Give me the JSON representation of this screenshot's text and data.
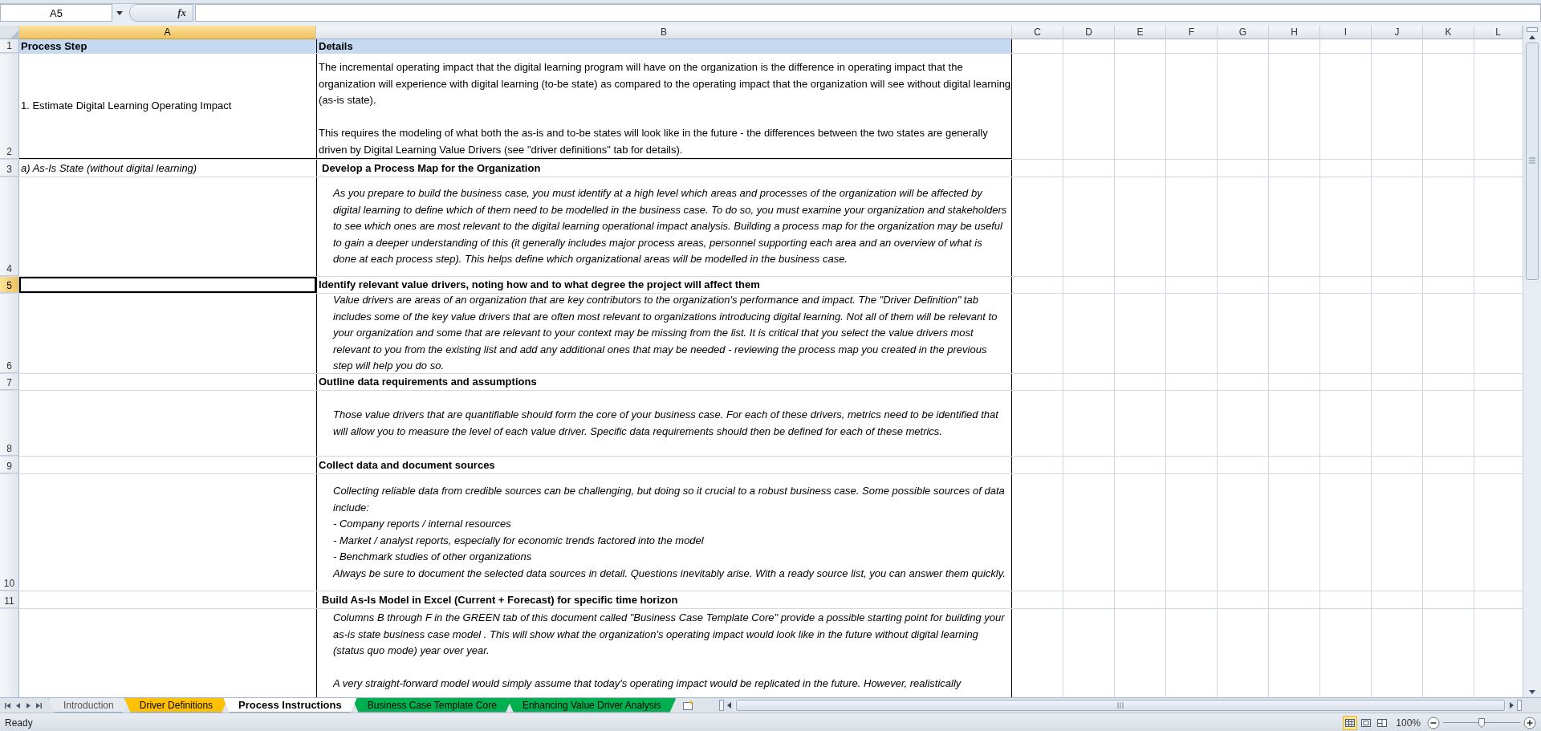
{
  "formula_bar": {
    "name_box": "A5",
    "function_button": "fx"
  },
  "columns": [
    {
      "label": "A",
      "selected": true
    },
    {
      "label": "B",
      "selected": false
    },
    {
      "label": "C",
      "selected": false
    },
    {
      "label": "D",
      "selected": false
    },
    {
      "label": "E",
      "selected": false
    },
    {
      "label": "F",
      "selected": false
    },
    {
      "label": "G",
      "selected": false
    },
    {
      "label": "H",
      "selected": false
    },
    {
      "label": "I",
      "selected": false
    },
    {
      "label": "J",
      "selected": false
    },
    {
      "label": "K",
      "selected": false
    },
    {
      "label": "L",
      "selected": false
    }
  ],
  "rows": [
    {
      "number": "1",
      "selected": false,
      "a": {
        "kind": "header",
        "text": "Process Step"
      },
      "b": {
        "kind": "header",
        "text": "Details"
      }
    },
    {
      "number": "2",
      "selected": false,
      "a": {
        "kind": "label",
        "text": "1. Estimate Digital Learning Operating Impact"
      },
      "b": {
        "kind": "paragraph",
        "text": "The incremental operating impact that the digital learning program will have on the organization is the difference in operating impact that the organization will experience with digital learning (to-be state) as compared to the operating impact that the organization will see without digital learning (as-is state).\n\nThis requires the modeling of what both the as-is and to-be states will look like in the future - the differences between the two states are generally driven by Digital Learning Value Drivers (see \"driver definitions\" tab for details)."
      }
    },
    {
      "number": "3",
      "selected": false,
      "a": {
        "kind": "italic_label",
        "text": "a) As-Is State (without digital learning)"
      },
      "b": {
        "kind": "heading",
        "indented": true,
        "text": "Develop a Process Map for the Organization"
      }
    },
    {
      "number": "4",
      "selected": false,
      "b": {
        "kind": "description",
        "text": "As you prepare to build the business case, you must identify at a high level which areas and processes of the organization will be affected by digital learning to define which of them need to be modelled in the business case. To do so, you must examine your organization and stakeholders to see which ones are most relevant to the digital learning operational impact analysis. Building a process map for the organization may be useful to gain a deeper understanding of this (it generally includes major process areas, personnel supporting each area and an overview of what is done at each process step). This helps define which organizational areas will be modelled in the business case."
      }
    },
    {
      "number": "5",
      "selected": true,
      "b": {
        "kind": "heading",
        "indented": false,
        "text": "Identify relevant value drivers, noting how and to what degree the project will affect them"
      }
    },
    {
      "number": "6",
      "selected": false,
      "b": {
        "kind": "description",
        "text": "Value drivers are areas of an organization that are key contributors to the organization's performance and impact. The \"Driver Definition\" tab includes some of the key value drivers that are often most relevant to organizations introducing digital learning. Not all of them will be relevant to your organization and some that are relevant to your context may be missing from the list. It is critical that you select the value drivers most relevant to you from the existing list and add any additional ones that may be needed - reviewing the process map you created in the previous step will help you do so."
      }
    },
    {
      "number": "7",
      "selected": false,
      "b": {
        "kind": "heading",
        "indented": false,
        "text": "Outline data requirements and assumptions"
      }
    },
    {
      "number": "8",
      "selected": false,
      "b": {
        "kind": "description",
        "text": "Those value drivers that are quantifiable should form the core of your business case. For each of these drivers, metrics need to be identified that will allow you to measure the level of each value driver. Specific data requirements should then be defined for each of these metrics."
      }
    },
    {
      "number": "9",
      "selected": false,
      "b": {
        "kind": "heading",
        "indented": false,
        "text": "Collect data and document sources"
      }
    },
    {
      "number": "10",
      "selected": false,
      "b": {
        "kind": "description",
        "text": "Collecting reliable data from credible sources can be challenging, but doing so it crucial to a robust business case. Some possible sources of data include:\n- Company reports / internal resources\n- Market / analyst reports, especially for economic trends factored into the model\n- Benchmark studies of other organizations\nAlways be sure to document the selected data sources in detail. Questions inevitably arise. With a ready source list, you can answer them quickly."
      }
    },
    {
      "number": "11",
      "selected": false,
      "b": {
        "kind": "heading",
        "indented": true,
        "text": "Build As-Is Model in Excel (Current + Forecast) for specific time horizon"
      }
    },
    {
      "selected": false,
      "b": {
        "kind": "description",
        "text": "Columns B through F in the GREEN tab of this document called \"Business Case Template Core\" provide a possible starting point for building your as-is state business case model . This will show what the organization's operating impact would look like in the future without digital learning (status quo mode) year over year.\n\nA very straight-forward model would simply assume that today's operating impact would be replicated in the future. However, realistically"
      }
    }
  ],
  "sheet_tabs": [
    {
      "label": "Introduction",
      "selected": false
    },
    {
      "label": "Driver Definitions",
      "selected": false,
      "color": "#ffc000"
    },
    {
      "label": "Process Instructions",
      "selected": true
    },
    {
      "label": "Business Case Template Core",
      "selected": false,
      "color": "#00b050"
    },
    {
      "label": "Enhancing Value Driver Analysis",
      "selected": false,
      "color": "#00b050"
    }
  ],
  "status_bar": {
    "text": "Ready",
    "views": [
      {
        "kind": "normal",
        "selected": true
      },
      {
        "kind": "page_layout",
        "selected": false
      },
      {
        "kind": "page_break",
        "selected": false
      }
    ],
    "zoom": "100%",
    "zoom_slider": {
      "level": 0.5
    }
  }
}
